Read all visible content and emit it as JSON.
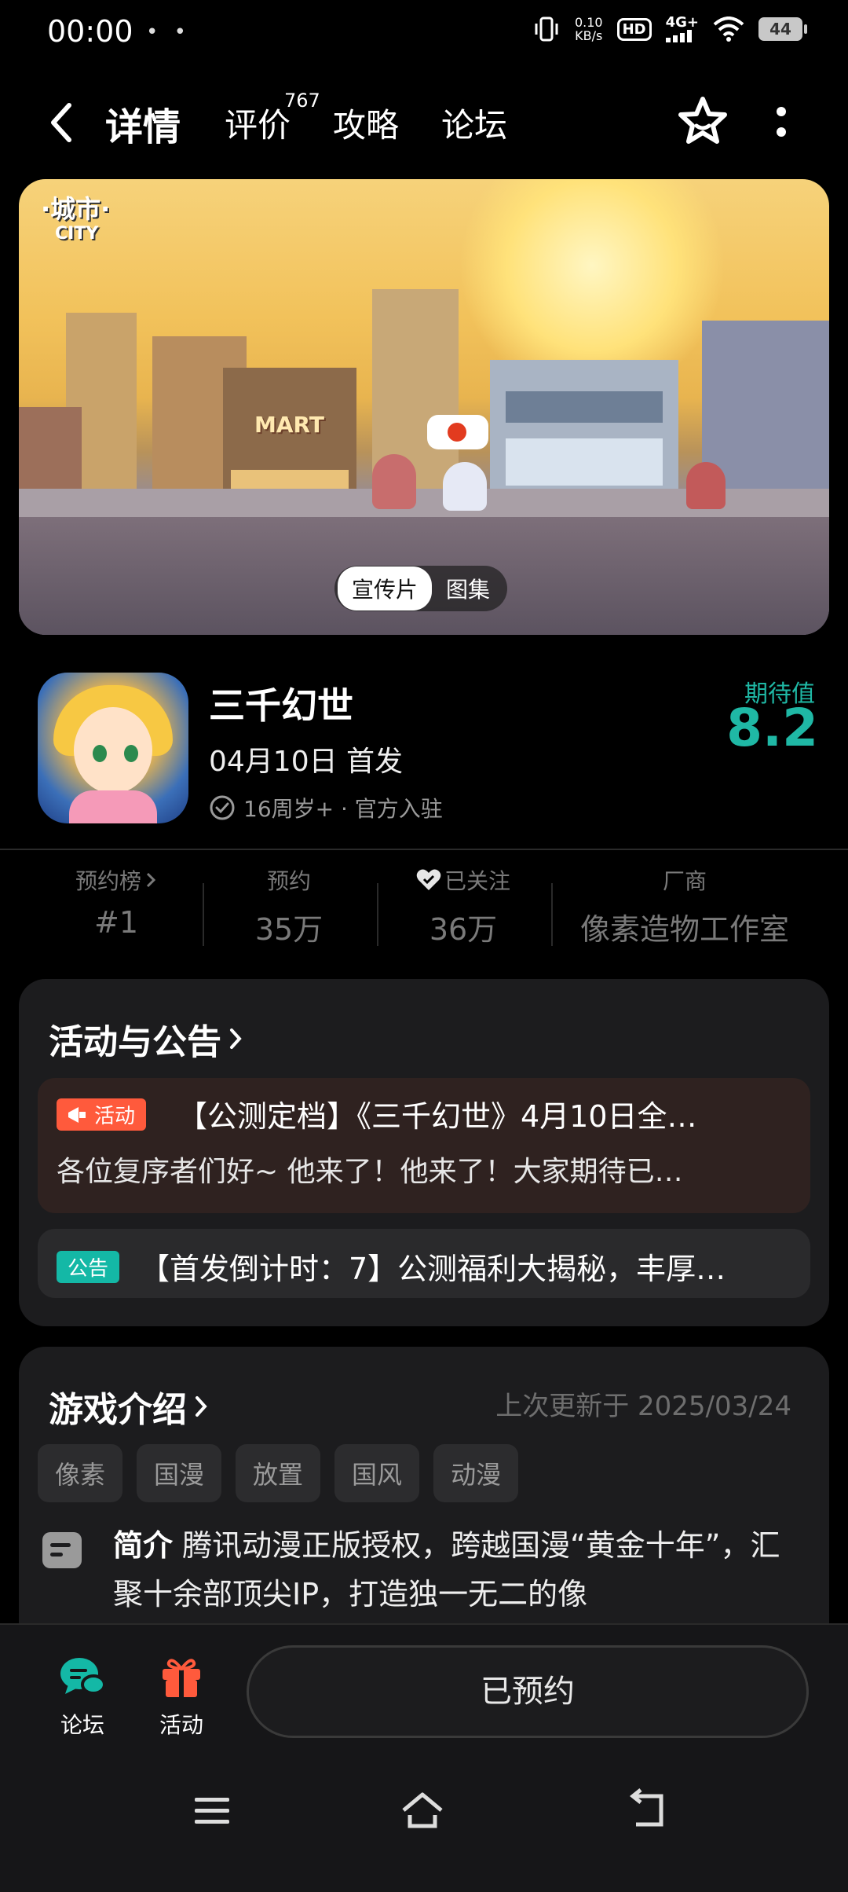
{
  "status_bar": {
    "time": "00:00",
    "dots": "• •",
    "net_speed_value": "0.10",
    "net_speed_unit": "KB/s",
    "hd": "HD",
    "network": "4G+",
    "battery": "44"
  },
  "nav": {
    "tabs": [
      {
        "label": "详情",
        "active": true
      },
      {
        "label": "评价"
      },
      {
        "label": "攻略"
      },
      {
        "label": "论坛"
      }
    ],
    "review_count": "767",
    "back_icon": "chevron-left-icon",
    "star_icon": "star-outline-icon",
    "more_icon": "more-vertical-icon"
  },
  "banner": {
    "logo_line1": "·城市·",
    "logo_line2": "CITY",
    "chips": [
      "宣传片",
      "图集"
    ],
    "selected_chip": "宣传片",
    "store_sign": "MART"
  },
  "game": {
    "title": "三千幻世",
    "release": "04月10日 首发",
    "meta": "16周岁+ · 官方入驻",
    "rating_label": "期待值",
    "rating_value": "8.2"
  },
  "stats": [
    {
      "label": "预约榜",
      "value": "#1",
      "has_chevron": true
    },
    {
      "label": "预约",
      "value": "35万"
    },
    {
      "label": "已关注",
      "value": "36万",
      "has_heart": true
    },
    {
      "label": "厂商",
      "value": "像素造物工作室"
    }
  ],
  "announcements": {
    "title": "活动与公告",
    "items": [
      {
        "tag": "活动",
        "title": "【公测定档】《三千幻世》4月10日全…",
        "body": "各位复序者们好~ 他来了！他来了！大家期待已…"
      },
      {
        "tag": "公告",
        "title": "【首发倒计时：7】公测福利大揭秘，丰厚…"
      }
    ]
  },
  "intro": {
    "title": "游戏介绍",
    "updated": "上次更新于 2025/03/24",
    "tags": [
      "像素",
      "国漫",
      "放置",
      "国风",
      "动漫"
    ],
    "summary_label": "简介",
    "summary_text": "腾讯动漫正版授权，跨越国漫“黄金十年”，汇聚十余部顶尖IP，打造独一无二的像"
  },
  "bottom": {
    "forum_label": "论坛",
    "activity_label": "活动",
    "reserved_label": "已预约"
  },
  "colors": {
    "accent": "#14b8a6",
    "activity": "#ff5a3c",
    "background": "#000000",
    "card": "#1c1c1e"
  }
}
